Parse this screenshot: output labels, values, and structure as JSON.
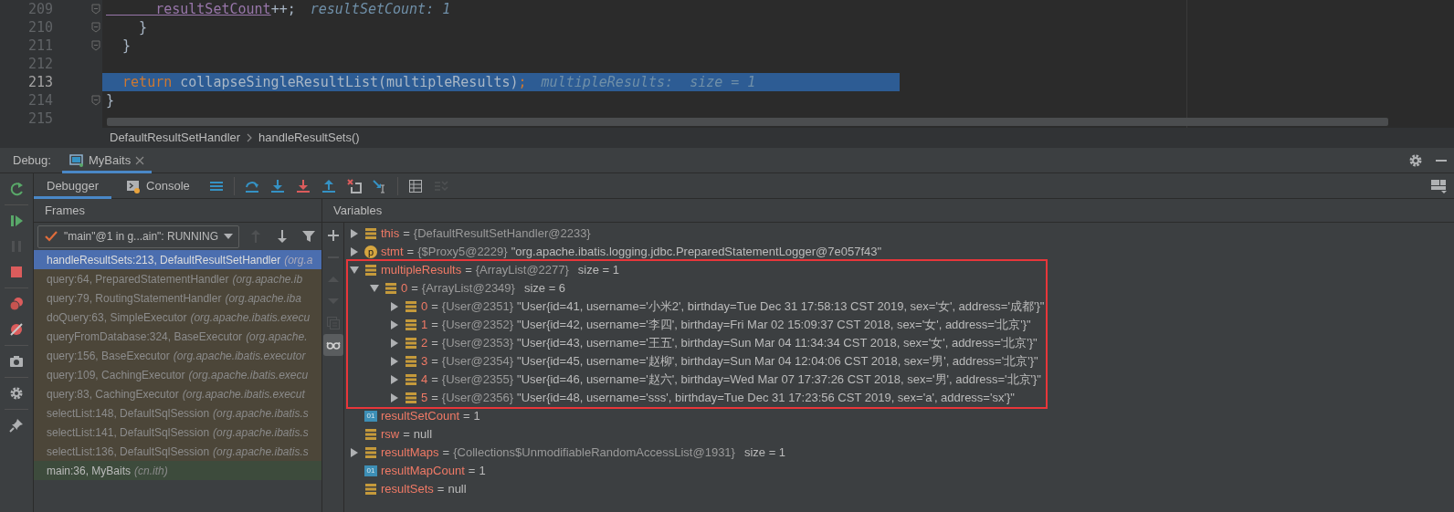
{
  "editor": {
    "lines": [
      {
        "number": "209",
        "fold": true,
        "current": false,
        "tokens": [
          {
            "kind": "field",
            "text": "      resultSetCount"
          },
          {
            "kind": "plain",
            "text": "++;"
          }
        ],
        "hint": "resultSetCount: 1"
      },
      {
        "number": "210",
        "fold": true,
        "current": false,
        "tokens": [
          {
            "kind": "plain",
            "text": "    }"
          }
        ]
      },
      {
        "number": "211",
        "fold": true,
        "current": false,
        "tokens": [
          {
            "kind": "plain",
            "text": "  }"
          }
        ]
      },
      {
        "number": "212",
        "fold": false,
        "current": false
      },
      {
        "number": "213",
        "fold": false,
        "current": true,
        "tokens": [
          {
            "kind": "keyword",
            "text": "  return"
          },
          {
            "kind": "plain",
            "text": " collapseSingleResultList(multipleResults)"
          },
          {
            "kind": "keyword",
            "text": ";"
          }
        ],
        "hint": "multipleResults:  size = 1"
      },
      {
        "number": "214",
        "fold": true,
        "current": false,
        "tokens": [
          {
            "kind": "plain",
            "text": "}"
          }
        ]
      },
      {
        "number": "215",
        "fold": false,
        "current": false
      }
    ],
    "breadcrumbs": [
      "DefaultResultSetHandler",
      "handleResultSets()"
    ]
  },
  "debug": {
    "label": "Debug:",
    "tabs": [
      {
        "label": "MyBaits",
        "selected": true
      }
    ]
  },
  "left_toolbar": [
    {
      "kind": "rerun",
      "disabled": false
    },
    {
      "kind": "resume",
      "disabled": false
    },
    {
      "kind": "pause",
      "disabled": true
    },
    {
      "kind": "stop",
      "disabled": false
    },
    {
      "kind": "breakpoints",
      "disabled": false
    },
    {
      "kind": "mute",
      "disabled": false
    },
    {
      "kind": "camera",
      "disabled": false
    },
    {
      "kind": "settings",
      "disabled": false
    },
    {
      "kind": "pin",
      "disabled": false
    }
  ],
  "tabs": [
    {
      "label": "Debugger",
      "selected": true
    },
    {
      "label": "Console",
      "selected": false
    }
  ],
  "toolbar": [
    {
      "kind": "menu",
      "disabled": false
    },
    {
      "kind": "step-over",
      "disabled": false
    },
    {
      "kind": "step-into",
      "disabled": false
    },
    {
      "kind": "force-step-into",
      "disabled": false
    },
    {
      "kind": "step-out",
      "disabled": false
    },
    {
      "kind": "drop-frame",
      "disabled": false
    },
    {
      "kind": "run-to-cursor",
      "disabled": false
    },
    {
      "kind": "evaluate",
      "disabled": false
    },
    {
      "kind": "trace",
      "disabled": true
    }
  ],
  "frames": {
    "title": "Frames",
    "thread": "\"main\"@1 in g...ain\": RUNNING",
    "toolbar": [
      {
        "kind": "up",
        "disabled": true
      },
      {
        "kind": "down",
        "disabled": false
      },
      {
        "kind": "filter",
        "disabled": false
      }
    ],
    "items": [
      {
        "method": "handleResultSets:213, DefaultResultSetHandler",
        "package": "(org.a",
        "selected": true,
        "library": true
      },
      {
        "method": "query:64, PreparedStatementHandler",
        "package": "(org.apache.ib",
        "selected": false,
        "library": true
      },
      {
        "method": "query:79, RoutingStatementHandler",
        "package": "(org.apache.iba",
        "selected": false,
        "library": true
      },
      {
        "method": "doQuery:63, SimpleExecutor",
        "package": "(org.apache.ibatis.execu",
        "selected": false,
        "library": true
      },
      {
        "method": "queryFromDatabase:324, BaseExecutor",
        "package": "(org.apache.",
        "selected": false,
        "library": true
      },
      {
        "method": "query:156, BaseExecutor",
        "package": "(org.apache.ibatis.executor",
        "selected": false,
        "library": true
      },
      {
        "method": "query:109, CachingExecutor",
        "package": "(org.apache.ibatis.execu",
        "selected": false,
        "library": true
      },
      {
        "method": "query:83, CachingExecutor",
        "package": "(org.apache.ibatis.execut",
        "selected": false,
        "library": true
      },
      {
        "method": "selectList:148, DefaultSqlSession",
        "package": "(org.apache.ibatis.s",
        "selected": false,
        "library": true
      },
      {
        "method": "selectList:141, DefaultSqlSession",
        "package": "(org.apache.ibatis.s",
        "selected": false,
        "library": true
      },
      {
        "method": "selectList:136, DefaultSqlSession",
        "package": "(org.apache.ibatis.s",
        "selected": false,
        "library": true
      },
      {
        "method": "main:36, MyBaits",
        "package": "(cn.ith)",
        "selected": false,
        "library": false
      }
    ]
  },
  "variables": {
    "title": "Variables",
    "toolbar": [
      {
        "kind": "plus",
        "disabled": false,
        "selected": false
      },
      {
        "kind": "minus",
        "disabled": true,
        "selected": false
      },
      {
        "kind": "up",
        "disabled": true,
        "selected": false
      },
      {
        "kind": "down",
        "disabled": true,
        "selected": false
      },
      {
        "kind": "copy",
        "disabled": true,
        "selected": false
      },
      {
        "kind": "glasses",
        "disabled": false,
        "selected": true
      }
    ],
    "items": [
      {
        "expanded": false,
        "kind": "object",
        "name": "this",
        "sep": "=",
        "ref": "{DefaultResultSetHandler@2233}",
        "highlighted": false
      },
      {
        "expanded": false,
        "kind": "parameter",
        "icon_text": "p",
        "name": "stmt",
        "sep": "=",
        "ref": "{$Proxy5@2229}",
        "value": "\"org.apache.ibatis.logging.jdbc.PreparedStatementLogger@7e057f43\"",
        "highlighted": false
      },
      {
        "expanded": true,
        "kind": "object",
        "name": "multipleResults",
        "sep": "=",
        "ref": "{ArrayList@2277}",
        "size": "size = 1",
        "highlighted": true,
        "children": [
          {
            "expanded": true,
            "kind": "object",
            "name": "0",
            "sep": "=",
            "ref": "{ArrayList@2349}",
            "size": "size = 6",
            "children": [
              {
                "expanded": false,
                "kind": "object",
                "name": "0",
                "sep": "=",
                "ref": "{User@2351}",
                "value": "\"User{id=41, username='小米2', birthday=Tue Dec 31 17:58:13 CST 2019, sex='女', address='成都'}\""
              },
              {
                "expanded": false,
                "kind": "object",
                "name": "1",
                "sep": "=",
                "ref": "{User@2352}",
                "value": "\"User{id=42, username='李四', birthday=Fri Mar 02 15:09:37 CST 2018, sex='女', address='北京'}\""
              },
              {
                "expanded": false,
                "kind": "object",
                "name": "2",
                "sep": "=",
                "ref": "{User@2353}",
                "value": "\"User{id=43, username='王五', birthday=Sun Mar 04 11:34:34 CST 2018, sex='女', address='北京'}\""
              },
              {
                "expanded": false,
                "kind": "object",
                "name": "3",
                "sep": "=",
                "ref": "{User@2354}",
                "value": "\"User{id=45, username='赵柳', birthday=Sun Mar 04 12:04:06 CST 2018, sex='男', address='北京'}\""
              },
              {
                "expanded": false,
                "kind": "object",
                "name": "4",
                "sep": "=",
                "ref": "{User@2355}",
                "value": "\"User{id=46, username='赵六', birthday=Wed Mar 07 17:37:26 CST 2018, sex='男', address='北京'}\""
              },
              {
                "expanded": false,
                "kind": "object",
                "name": "5",
                "sep": "=",
                "ref": "{User@2356}",
                "value": "\"User{id=48, username='sss', birthday=Tue Dec 31 17:23:56 CST 2019, sex='a', address='sx'}\""
              }
            ]
          }
        ]
      },
      {
        "kind": "primitive",
        "icon_text": "01",
        "name": "resultSetCount",
        "sep": "=",
        "value": "1",
        "highlighted": false
      },
      {
        "kind": "object",
        "name": "rsw",
        "sep": "=",
        "value": "null",
        "highlighted": false
      },
      {
        "expanded": false,
        "kind": "object",
        "name": "resultMaps",
        "sep": "=",
        "ref": "{Collections$UnmodifiableRandomAccessList@1931}",
        "size": "size = 1",
        "highlighted": false
      },
      {
        "kind": "primitive",
        "icon_text": "01",
        "name": "resultMapCount",
        "sep": "=",
        "value": "1",
        "highlighted": false
      },
      {
        "kind": "object",
        "name": "resultSets",
        "sep": "=",
        "value": "null",
        "highlighted": false
      }
    ]
  }
}
